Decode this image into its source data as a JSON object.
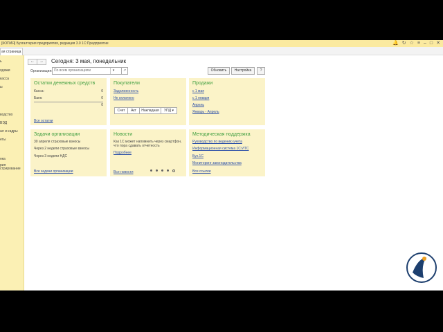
{
  "window": {
    "title": "[КОПИЯ] Бухгалтерия предприятия, редакция 3.0 1С:Предприятие"
  },
  "tabs": [
    {
      "label": "ая страница"
    }
  ],
  "sidebar": {
    "items": [
      "ь",
      "одажи",
      "касса",
      "ы",
      "водство",
      "ВЭД",
      "ал и кадры",
      "еты",
      "нка",
      "рия",
      "стрирование"
    ]
  },
  "nav": {
    "back_icon": "arrow-left-icon",
    "forward_icon": "arrow-right-icon"
  },
  "page": {
    "title": "Сегодня: 3 мая, понедельник",
    "org_label": "Организация:",
    "org_placeholder": "По всем организациям",
    "refresh_label": "Обновить",
    "settings_label": "Настройка",
    "help_label": "?"
  },
  "cash": {
    "title": "Остатки денежных средств",
    "rows": [
      {
        "label": "Касса:",
        "value": "0"
      },
      {
        "label": "Банк:",
        "value": "0"
      }
    ],
    "total": "0",
    "link": "Все остатки"
  },
  "buyers": {
    "title": "Покупатели",
    "links": [
      "Задолженность",
      "Не оплачено"
    ],
    "buttons": [
      "Счет",
      "Акт",
      "Накладная",
      "УПД"
    ]
  },
  "sales": {
    "title": "Продажи",
    "links": [
      "с 1 мая",
      "с 1 января",
      "Апрель",
      "Январь - Апрель"
    ]
  },
  "tasks": {
    "title": "Задачи организации",
    "items": [
      "30 апреля страховые взносы",
      "Через 2 недели страховые взносы",
      "Через 3 недели НДС"
    ],
    "link": "Все задачи организации"
  },
  "news": {
    "title": "Новости",
    "text_line1": "Как 1С может напомнить через смартфон,",
    "text_line2": "что пора сдавать отчетность",
    "more": "Подробнее",
    "link": "Все новости"
  },
  "support": {
    "title": "Методическая поддержка",
    "links": [
      "Руководство по ведению учета",
      "Информационная система 1С:ИТС",
      "Бух.1С",
      "Мониторинг законодательства"
    ],
    "all": "Все ссылки"
  },
  "colors": {
    "accent": "#3f9e3f",
    "panel": "#fbf3c8",
    "sidebar": "#fbf0b4",
    "link": "#2b4fa8"
  }
}
